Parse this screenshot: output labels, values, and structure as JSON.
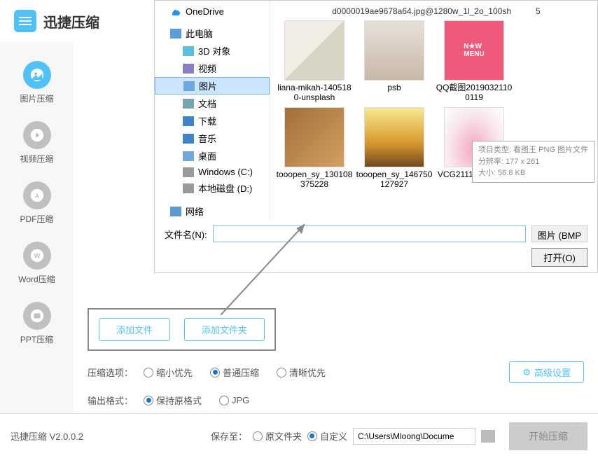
{
  "app": {
    "title": "迅捷压缩",
    "version": "迅捷压缩 V2.0.0.2"
  },
  "sidebar": {
    "items": [
      {
        "label": "图片压缩"
      },
      {
        "label": "视频压缩"
      },
      {
        "label": "PDF压缩"
      },
      {
        "label": "Word压缩"
      },
      {
        "label": "PPT压缩"
      }
    ]
  },
  "buttons": {
    "add_file": "添加文件",
    "add_folder": "添加文件夹",
    "advanced": "高级设置",
    "start": "开始压缩",
    "open": "打开(O)"
  },
  "options": {
    "compress_label": "压缩选项：",
    "opt_small": "缩小优先",
    "opt_normal": "普通压缩",
    "opt_clear": "清晰优先",
    "format_label": "输出格式：",
    "fmt_keep": "保持原格式",
    "fmt_jpg": "JPG"
  },
  "footer": {
    "save_to": "保存至：",
    "original_folder": "原文件夹",
    "custom": "自定义",
    "path": "C:\\Users\\Mloong\\Docume"
  },
  "dialog": {
    "tree": {
      "onedrive": "OneDrive",
      "this_pc": "此电脑",
      "obj3d": "3D 对象",
      "video": "视频",
      "pictures": "图片",
      "documents": "文档",
      "downloads": "下载",
      "music": "音乐",
      "desktop": "桌面",
      "drive_c": "Windows (C:)",
      "drive_d": "本地磁盘 (D:)",
      "network": "网络"
    },
    "top_text": {
      "c1": "d0000019ae9678a64.jpg@1280w_1l_2o_100sh",
      "c2": "5"
    },
    "files": [
      "liana-mikah-1405180-unsplash",
      "psb",
      "QQ截图20190321100119",
      "tooopen_sy_130108375228",
      "tooopen_sy_146750127927",
      "VCG211123450486"
    ],
    "tooltip": {
      "l1": "项目类型: 看图王 PNG 图片文件",
      "l2": "分辨率: 177 x 261",
      "l3": "大小: 56.8 KB"
    },
    "filename_label": "文件名(N):",
    "filter": "图片 (BMP"
  }
}
